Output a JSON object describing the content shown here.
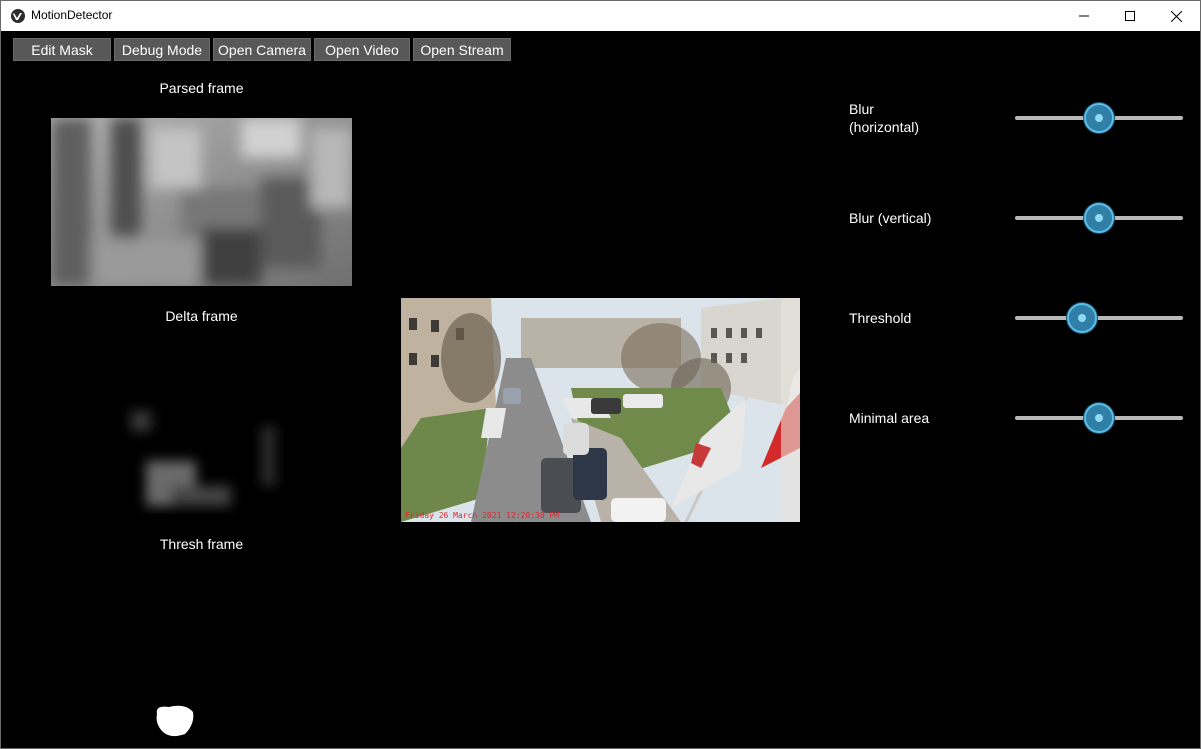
{
  "window": {
    "title": "MotionDetector"
  },
  "toolbar": {
    "buttons": [
      "Edit Mask",
      "Debug Mode",
      "Open Camera",
      "Open Video",
      "Open Stream"
    ]
  },
  "frames": {
    "parsed_label": "Parsed frame",
    "delta_label": "Delta frame",
    "thresh_label": "Thresh frame",
    "camera_overlay": "Friday 26 March 2021 12:20:38 PM"
  },
  "sliders": [
    {
      "label": "Blur\n(horizontal)",
      "value": 0.5
    },
    {
      "label": "Blur (vertical)",
      "value": 0.5
    },
    {
      "label": "Threshold",
      "value": 0.4
    },
    {
      "label": "Minimal area",
      "value": 0.5
    }
  ],
  "colors": {
    "thumb": "#2f7fa6",
    "track": "#b9b9b9",
    "button": "#585858"
  }
}
